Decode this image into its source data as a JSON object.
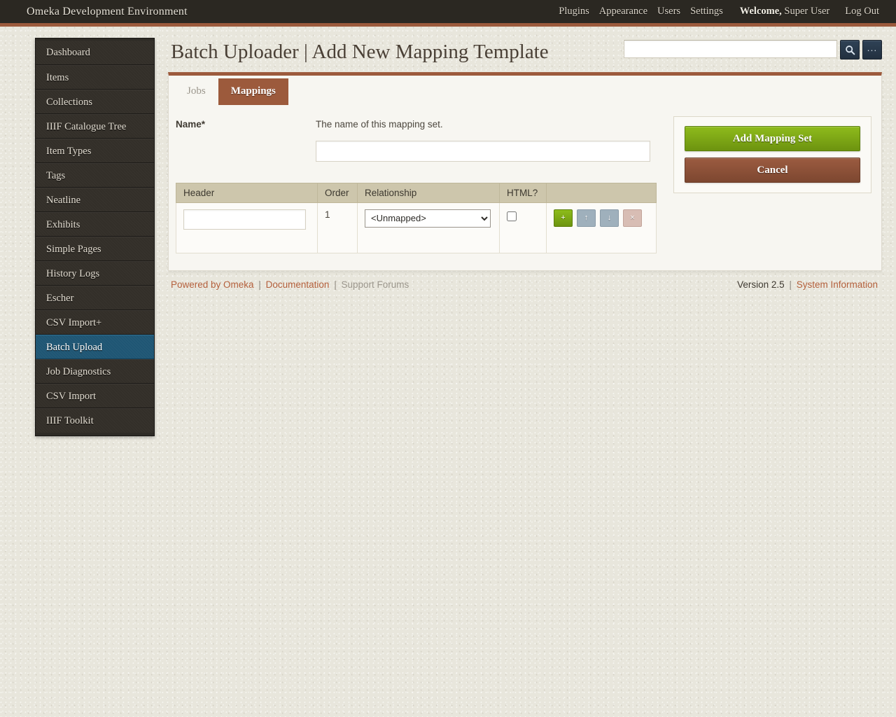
{
  "topbar": {
    "site_title": "Omeka Development Environment",
    "nav": [
      "Plugins",
      "Appearance",
      "Users",
      "Settings"
    ],
    "welcome_word": "Welcome,",
    "user_name": "Super User",
    "logout": "Log Out",
    "accent_color": "#9c5a3c",
    "bar_color": "#2b2822"
  },
  "sidebar": {
    "items": [
      {
        "label": "Dashboard",
        "active": false
      },
      {
        "label": "Items",
        "active": false
      },
      {
        "label": "Collections",
        "active": false
      },
      {
        "label": "IIIF Catalogue Tree",
        "active": false
      },
      {
        "label": "Item Types",
        "active": false
      },
      {
        "label": "Tags",
        "active": false
      },
      {
        "label": "Neatline",
        "active": false
      },
      {
        "label": "Exhibits",
        "active": false
      },
      {
        "label": "Simple Pages",
        "active": false
      },
      {
        "label": "History Logs",
        "active": false
      },
      {
        "label": "Escher",
        "active": false
      },
      {
        "label": "CSV Import+",
        "active": false
      },
      {
        "label": "Batch Upload",
        "active": true
      },
      {
        "label": "Job Diagnostics",
        "active": false
      },
      {
        "label": "CSV Import",
        "active": false
      },
      {
        "label": "IIIF Toolkit",
        "active": false
      }
    ],
    "active_color": "#1f5674"
  },
  "header": {
    "page_title": "Batch Uploader | Add New Mapping Template",
    "search_value": "",
    "search_placeholder": "",
    "search_icon": "search-icon",
    "options_label": "..."
  },
  "tabs": [
    {
      "label": "Jobs",
      "active": false
    },
    {
      "label": "Mappings",
      "active": true
    }
  ],
  "form": {
    "name_label": "Name*",
    "name_description": "The name of this mapping set.",
    "name_value": "",
    "name_placeholder": ""
  },
  "table": {
    "columns": [
      "Header",
      "Order",
      "Relationship",
      "HTML?",
      ""
    ],
    "rows": [
      {
        "header_value": "",
        "header_placeholder": "",
        "order": "1",
        "relationship_selected": "<Unmapped>",
        "relationship_options": [
          "<Unmapped>"
        ],
        "html_checked": false,
        "actions": [
          {
            "name": "add-row-button",
            "glyph": "+",
            "color": "#7da515"
          },
          {
            "name": "move-up-button",
            "glyph": "↑",
            "color": "#9fb0bc"
          },
          {
            "name": "move-down-button",
            "glyph": "↓",
            "color": "#9fb0bc"
          },
          {
            "name": "delete-row-button",
            "glyph": "×",
            "color": "#d8bdb4"
          }
        ]
      }
    ]
  },
  "side_panel": {
    "submit_label": "Add Mapping Set",
    "cancel_label": "Cancel",
    "submit_color": "#7da515",
    "cancel_color": "#8a4f36"
  },
  "footer": {
    "powered_by": "Powered by Omeka",
    "documentation": "Documentation",
    "support_forums": "Support Forums",
    "version": "Version 2.5",
    "system_information": "System Information",
    "separator": "|"
  }
}
